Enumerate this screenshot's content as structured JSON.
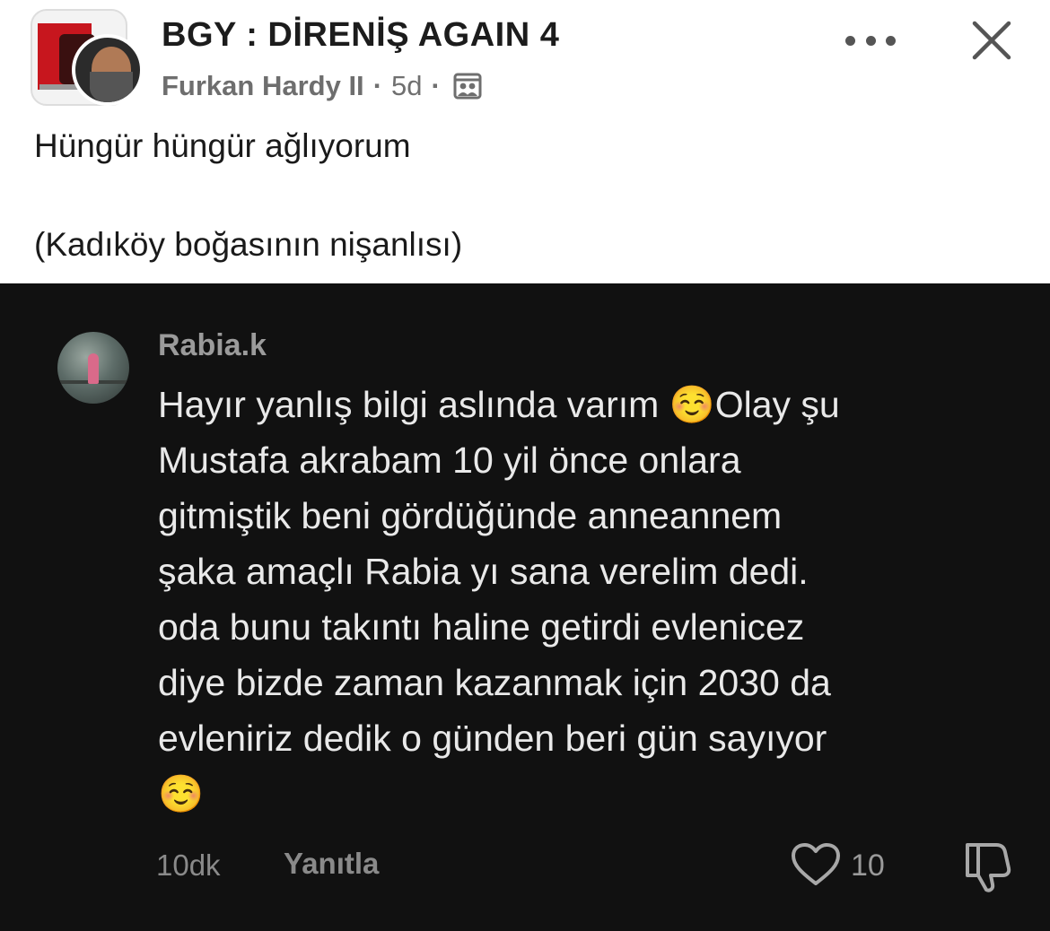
{
  "post": {
    "group_title": "BGY : DİRENİŞ AGAIN 4",
    "author": "Furkan Hardy II",
    "separator": "·",
    "age": "5d",
    "text_line_1": "Hüngür hüngür ağlıyorum",
    "text_line_2": "(Kadıköy boğasının nişanlısı)"
  },
  "icons": {
    "more": "more-dots-icon",
    "close": "close-icon",
    "audience": "group-audience-icon",
    "like": "heart-outline-icon",
    "dislike": "thumbs-down-icon"
  },
  "comment": {
    "author": "Rabia.k",
    "body": "Hayır yanlış bilgi aslında varım ☺️Olay şu\nMustafa akrabam 10 yil önce onlara\ngitmiştik beni gördüğünde anneannem\nşaka amaçlı Rabia yı sana verelim dedi.\noda bunu takıntı haline getirdi evlenicez\ndiye bizde zaman kazanmak için 2030 da\nevleniriz dedik o günden beri gün sayıyor\n☺️",
    "time": "10dk",
    "reply_label": "Yanıtla",
    "like_count": "10"
  },
  "colors": {
    "panel_background": "#111111",
    "comment_text": "#e9e9e9",
    "muted_text": "#8a8a8a"
  }
}
